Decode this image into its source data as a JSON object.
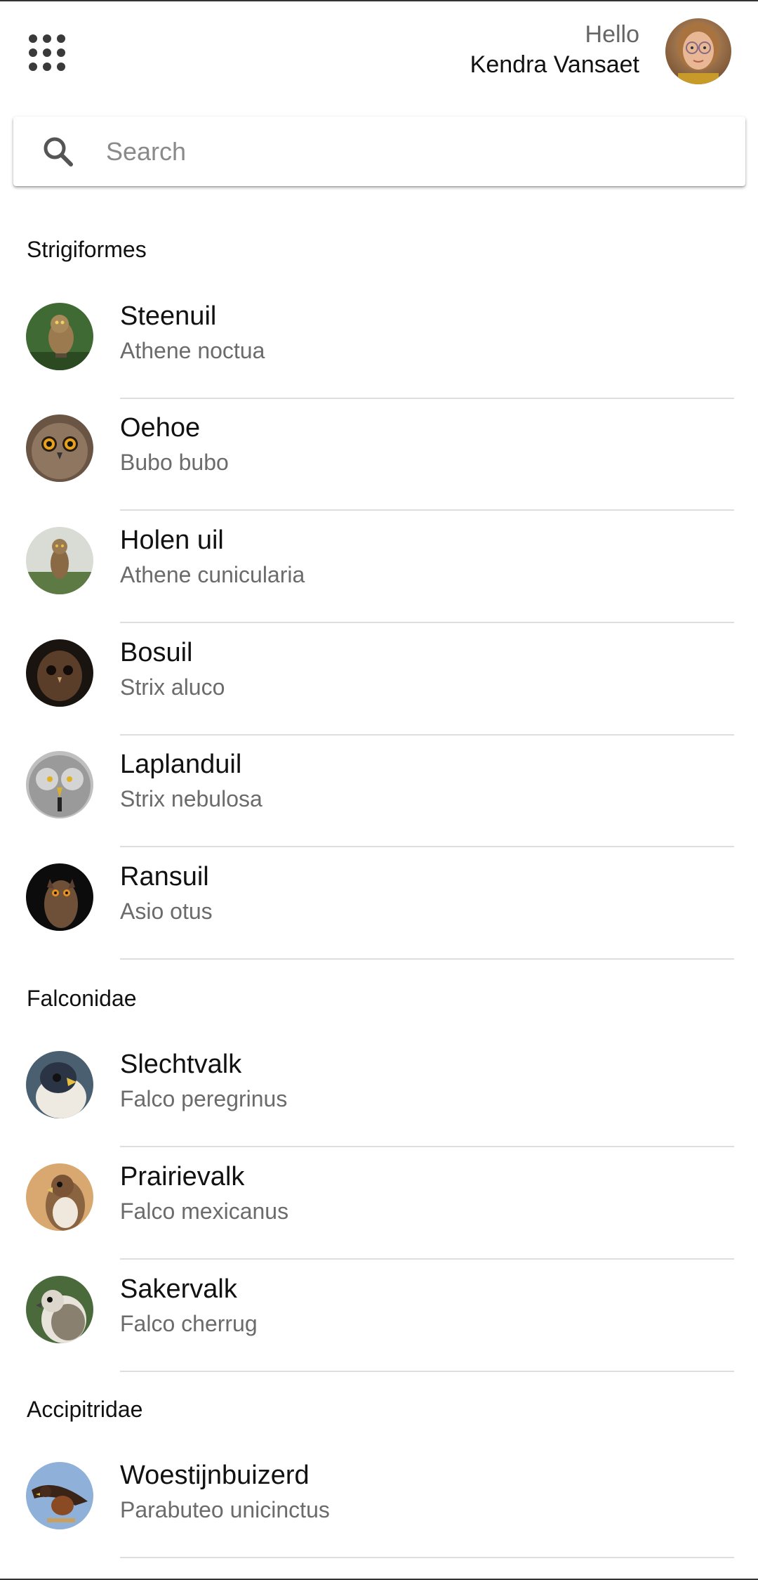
{
  "header": {
    "greeting": "Hello",
    "user_name": "Kendra Vansaet",
    "apps_icon": "grid-apps-icon",
    "avatar": "user-avatar"
  },
  "search": {
    "placeholder": "Search",
    "value": "",
    "icon": "search-icon"
  },
  "sections": [
    {
      "title": "Strigiformes",
      "items": [
        {
          "name": "Steenuil",
          "latin": "Athene noctua"
        },
        {
          "name": "Oehoe",
          "latin": "Bubo bubo"
        },
        {
          "name": "Holen uil",
          "latin": "Athene cunicularia"
        },
        {
          "name": "Bosuil",
          "latin": "Strix aluco"
        },
        {
          "name": "Laplanduil",
          "latin": "Strix nebulosa"
        },
        {
          "name": "Ransuil",
          "latin": "Asio otus"
        }
      ]
    },
    {
      "title": "Falconidae",
      "items": [
        {
          "name": "Slechtvalk",
          "latin": "Falco peregrinus"
        },
        {
          "name": "Prairievalk",
          "latin": "Falco mexicanus"
        },
        {
          "name": "Sakervalk",
          "latin": "Falco cherrug"
        }
      ]
    },
    {
      "title": "Accipitridae",
      "items": [
        {
          "name": "Woestijnbuizerd",
          "latin": "Parabuteo unicinctus"
        }
      ]
    }
  ],
  "colors": {
    "text_primary": "#111111",
    "text_secondary": "#6b6b6b",
    "divider": "#dedede"
  }
}
